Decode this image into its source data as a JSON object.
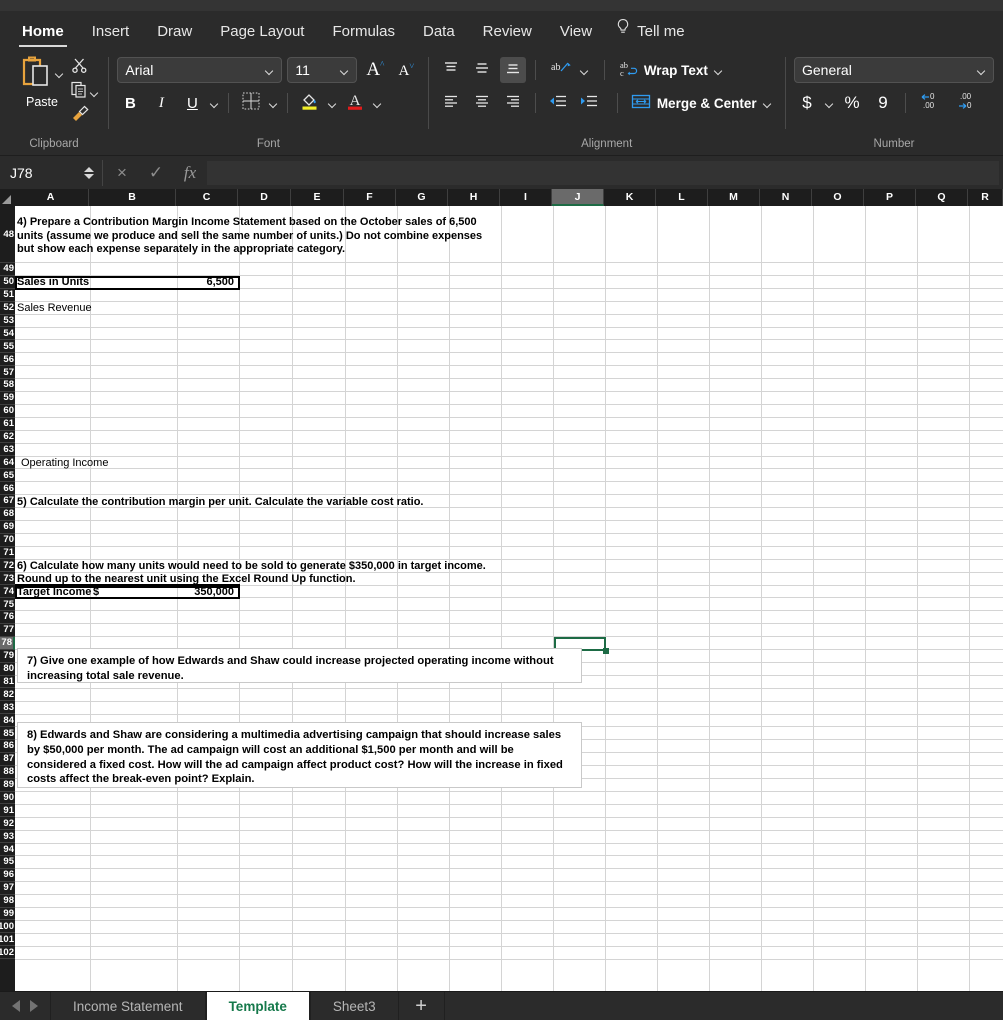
{
  "app": {
    "ribbon_tabs": [
      {
        "label": "Home",
        "active": true
      },
      {
        "label": "Insert",
        "active": false
      },
      {
        "label": "Draw",
        "active": false
      },
      {
        "label": "Page Layout",
        "active": false
      },
      {
        "label": "Formulas",
        "active": false
      },
      {
        "label": "Data",
        "active": false
      },
      {
        "label": "Review",
        "active": false
      },
      {
        "label": "View",
        "active": false
      }
    ],
    "tell_me": "Tell me"
  },
  "ribbon": {
    "clipboard": {
      "group_label": "Clipboard",
      "paste_label": "Paste"
    },
    "font": {
      "group_label": "Font",
      "font_name": "Arial",
      "font_size": "11",
      "bold": "B",
      "italic": "I",
      "underline": "U"
    },
    "alignment": {
      "group_label": "Alignment",
      "wrap_text": "Wrap Text",
      "merge_center": "Merge & Center"
    },
    "number": {
      "group_label": "Number",
      "format": "General",
      "currency": "$",
      "percent": "%",
      "comma": "9"
    }
  },
  "formula_bar": {
    "name_box": "J78",
    "formula": "",
    "cancel": "×",
    "enter": "✓",
    "fx": "fx"
  },
  "grid": {
    "columns": [
      "A",
      "B",
      "C",
      "D",
      "E",
      "F",
      "G",
      "H",
      "I",
      "J",
      "K",
      "L",
      "M",
      "N",
      "O",
      "P",
      "Q",
      "R"
    ],
    "selected_column": "J",
    "selected_row": "78",
    "selected_cell": "J78",
    "row_start": 48,
    "row_end": 102,
    "cells": [
      {
        "ref": "A48",
        "text": "4)  Prepare a Contribution Margin Income Statement  based on the October sales of 6,500 units (assume we produce and sell the same number of units.)  Do not combine expenses but show each expense separately in the appropriate category."
      },
      {
        "ref": "A50",
        "text": "Sales in Units"
      },
      {
        "ref": "C50",
        "text": "6,500"
      },
      {
        "ref": "A52",
        "text": "Sales Revenue"
      },
      {
        "ref": "A64",
        "text": "Operating Income"
      },
      {
        "ref": "A67",
        "text": "5)  Calculate the contribution margin per unit.  Calculate the variable cost ratio."
      },
      {
        "ref": "A72",
        "text": "6)  Calculate how many units would need to be sold to generate $350,000 in target income."
      },
      {
        "ref": "A73",
        "text": " Round up to the nearest unit using the Excel Round Up function."
      },
      {
        "ref": "A74",
        "text": "Target Income"
      },
      {
        "ref": "B74",
        "text": "$"
      },
      {
        "ref": "C74",
        "text": "350,000"
      }
    ],
    "textboxes": [
      {
        "id": "tb7",
        "text": "7) Give one example of how Edwards and Shaw could increase projected operating income without increasing total sale revenue."
      },
      {
        "id": "tb8",
        "text": "8) Edwards and Shaw are considering a multimedia advertising campaign that should increase sales by $50,000 per month. The ad campaign will cost  an additional $1,500 per month and will be considered a fixed cost.  How will the ad campaign affect product cost?  How will the increase in fixed costs affect the break-even point?  Explain."
      }
    ]
  },
  "sheet_tabs": {
    "tabs": [
      {
        "label": "Income Statement",
        "active": false
      },
      {
        "label": "Template",
        "active": true
      },
      {
        "label": "Sheet3",
        "active": false
      }
    ],
    "add_label": "+"
  },
  "colors": {
    "accent_green": "#1d6b45",
    "ribbon_bg": "#2b2b2b",
    "grid_line": "#d4d4d4"
  }
}
